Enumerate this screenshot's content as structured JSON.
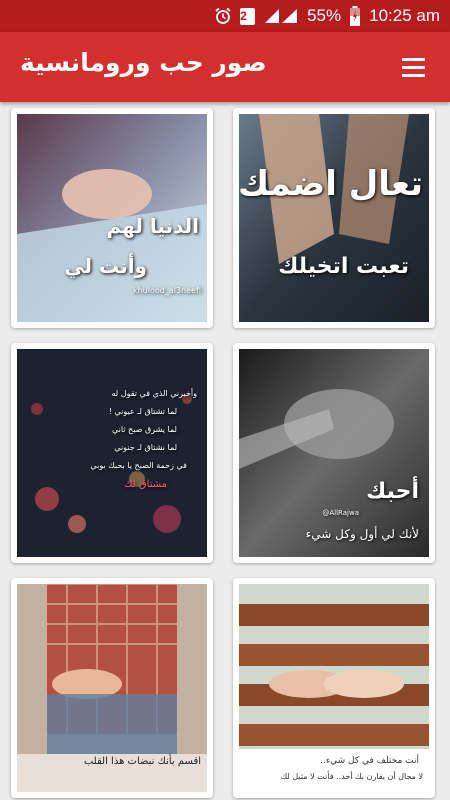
{
  "status_bar": {
    "alarm_icon": "alarm-icon",
    "sim": "2",
    "battery": "55%",
    "time": "10:25 am"
  },
  "app_bar": {
    "title": "صور حب ورومانسية",
    "menu_icon": "hamburger-menu-icon"
  },
  "cards": [
    {
      "lines": [
        "تعال اضمك",
        "تعبت اتخيلك"
      ]
    },
    {
      "lines": [
        "الدنيا لهم",
        "وأنت لي",
        "khulood_al3neefi"
      ]
    },
    {
      "lines": [
        "أحبك",
        "لأنك لي أول وكل شيء",
        "@AllRajwa"
      ]
    },
    {
      "lines": [
        "وأخبرني الذي في تقول له",
        "لما تشتاق لـ عيوني !",
        "لما يشرق صبح ثاني",
        "لما نشتاق لـ جنوني",
        "في زحمة الصبح يا بحبك بوبي",
        "مشتاق لك"
      ]
    },
    {
      "lines": [
        "أنت مختلف في كل شيء..",
        "لا مجال أن يقارن بك أحد.. فأنت لا مثيل لك"
      ]
    },
    {
      "lines": [
        "اقسم بأنك نبضات هذا القلب"
      ]
    }
  ]
}
